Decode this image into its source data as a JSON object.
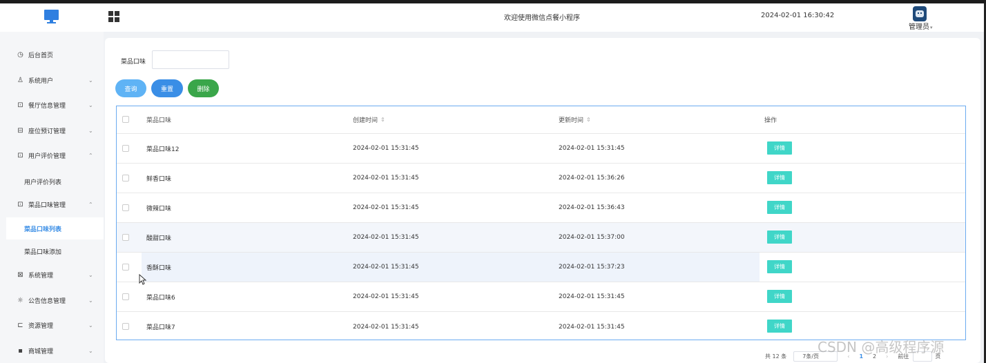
{
  "header": {
    "welcome": "欢迎使用微信点餐小程序",
    "datetime": "2024-02-01 16:30:42",
    "user": "管理员",
    "logo_icon": "monitor-icon",
    "menu_toggle_icon": "grid-icon"
  },
  "sidebar": {
    "items": [
      {
        "label": "后台首页",
        "icon": "clock-icon",
        "glyph": "◷"
      },
      {
        "label": "系统用户",
        "icon": "user-icon",
        "glyph": "♙",
        "chevron": "⌄"
      },
      {
        "label": "餐厅信息管理",
        "icon": "chart-icon",
        "glyph": "⊡",
        "chevron": "⌄"
      },
      {
        "label": "座位预订管理",
        "icon": "list-icon",
        "glyph": "⊟",
        "chevron": "⌄"
      },
      {
        "label": "用户评价管理",
        "icon": "chart-icon",
        "glyph": "⊡",
        "chevron": "⌃"
      },
      {
        "label": "菜品口味管理",
        "icon": "chart-icon",
        "glyph": "⊡",
        "chevron": "⌃"
      },
      {
        "label": "系统管理",
        "icon": "folder-icon",
        "glyph": "⊠",
        "chevron": "⌄"
      },
      {
        "label": "公告信息管理",
        "icon": "sun-icon",
        "glyph": "☼",
        "chevron": "⌄"
      },
      {
        "label": "资源管理",
        "icon": "monitor-icon",
        "glyph": "⊏",
        "chevron": "⌄"
      },
      {
        "label": "商城管理",
        "icon": "shop-icon",
        "glyph": "▪",
        "chevron": "⌄"
      }
    ],
    "subitems": {
      "review_list": "用户评价列表",
      "flavor_list": "菜品口味列表",
      "flavor_add": "菜品口味添加"
    }
  },
  "filter": {
    "label": "菜品口味",
    "value": "",
    "placeholder": ""
  },
  "buttons": {
    "search": "查询",
    "reset": "重置",
    "delete": "删除"
  },
  "table": {
    "columns": [
      "菜品口味",
      "创建时间",
      "更新时间",
      "操作"
    ],
    "sort_glyph": "⇕",
    "rows": [
      {
        "name": "菜品口味12",
        "created": "2024-02-01 15:31:45",
        "updated": "2024-02-01 15:31:45",
        "action": "详情"
      },
      {
        "name": "鲜香口味",
        "created": "2024-02-01 15:31:45",
        "updated": "2024-02-01 15:36:26",
        "action": "详情"
      },
      {
        "name": "微辣口味",
        "created": "2024-02-01 15:31:45",
        "updated": "2024-02-01 15:36:43",
        "action": "详情"
      },
      {
        "name": "酸甜口味",
        "created": "2024-02-01 15:31:45",
        "updated": "2024-02-01 15:37:00",
        "action": "详情"
      },
      {
        "name": "香酥口味",
        "created": "2024-02-01 15:31:45",
        "updated": "2024-02-01 15:37:23",
        "action": "详情"
      },
      {
        "name": "菜品口味6",
        "created": "2024-02-01 15:31:45",
        "updated": "2024-02-01 15:31:45",
        "action": "详情"
      },
      {
        "name": "菜品口味7",
        "created": "2024-02-01 15:31:45",
        "updated": "2024-02-01 15:31:45",
        "action": "详情"
      }
    ]
  },
  "pagination": {
    "total": "共 12 条",
    "page_size": "7条/页",
    "prev": "‹",
    "pages": [
      "1",
      "2"
    ],
    "next": "›",
    "goto": "前往",
    "goto_unit": "页"
  },
  "watermark": "CSDN @高级程序源",
  "colors": {
    "primary": "#3a8ee6",
    "search_button": "#5fb3f5",
    "delete_button": "#3aa64a",
    "detail_button": "#40d6c8"
  }
}
